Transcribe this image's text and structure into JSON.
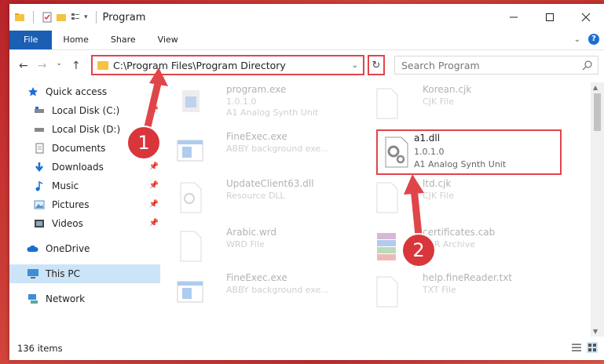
{
  "window": {
    "title": "Program"
  },
  "ribbon": {
    "tabs": [
      "File",
      "Home",
      "Share",
      "View"
    ]
  },
  "address": {
    "path": "C:\\Program Files\\Program Directory",
    "search_placeholder": "Search Program"
  },
  "sidebar": {
    "items": [
      {
        "label": "Quick access",
        "icon": "star-icon"
      },
      {
        "label": "Local Disk (C:)",
        "icon": "drive-icon"
      },
      {
        "label": "Local Disk (D:)",
        "icon": "drive-icon"
      },
      {
        "label": "Documents",
        "icon": "documents-icon"
      },
      {
        "label": "Downloads",
        "icon": "download-icon"
      },
      {
        "label": "Music",
        "icon": "music-icon"
      },
      {
        "label": "Pictures",
        "icon": "pictures-icon"
      },
      {
        "label": "Videos",
        "icon": "videos-icon"
      },
      {
        "label": "OneDrive",
        "icon": "cloud-icon"
      },
      {
        "label": "This PC",
        "icon": "computer-icon"
      },
      {
        "label": "Network",
        "icon": "network-icon"
      }
    ]
  },
  "files": [
    {
      "name": "program.exe",
      "sub1": "1.0.1.0",
      "sub2": "A1 Analog Synth Unit"
    },
    {
      "name": "Korean.cjk",
      "sub1": "CJK File",
      "sub2": ""
    },
    {
      "name": "FineExec.exe",
      "sub1": "ABBY background exe...",
      "sub2": ""
    },
    {
      "name": "a1.dll",
      "sub1": "1.0.1.0",
      "sub2": "A1 Analog Synth Unit"
    },
    {
      "name": "UpdateClient63.dll",
      "sub1": "Resource DLL",
      "sub2": ""
    },
    {
      "name": "Arabic.wrd",
      "sub1": "WRD File",
      "sub2": ""
    },
    {
      "name": "FineExec.exe",
      "sub1": "ABBY background exe...",
      "sub2": ""
    },
    {
      "name": "certificates.cab",
      "sub1": "RAR Archive",
      "sub2": ""
    },
    {
      "name": "help.fineReader.txt",
      "sub1": "TXT File",
      "sub2": ""
    },
    {
      "name": "ltd.cjk",
      "sub1": "CJK File",
      "sub2": ""
    }
  ],
  "status": {
    "count": "136 items"
  },
  "annotations": {
    "badge1": "1",
    "badge2": "2"
  },
  "colors": {
    "accent": "#1a5fb4",
    "highlight": "#e0454a",
    "badge": "#d9363c"
  }
}
